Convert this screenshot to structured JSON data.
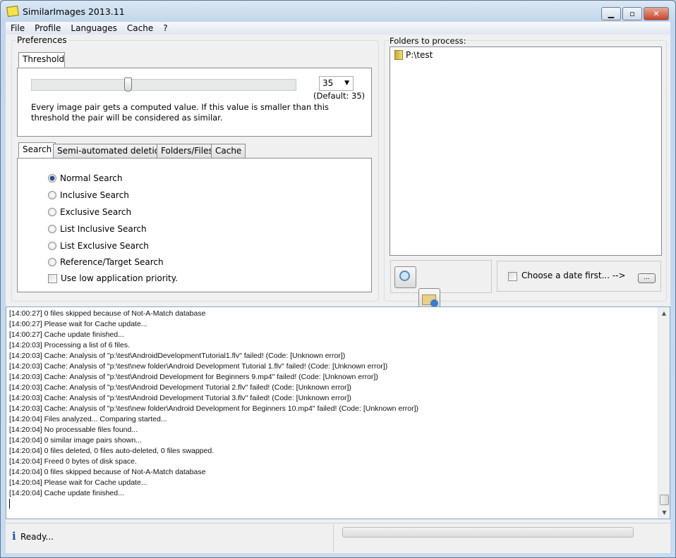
{
  "window": {
    "title": "SimilarImages 2013.11"
  },
  "menu": [
    "File",
    "Profile",
    "Languages",
    "Cache",
    "?"
  ],
  "preferences": {
    "label": "Preferences",
    "threshold_tab": "Threshold",
    "threshold_value": "35",
    "threshold_fraction": 0.35,
    "default_label": "(Default: 35)",
    "description": "Every image pair gets a computed value. If this value is smaller than this threshold the pair will be considered as similar."
  },
  "tabs": [
    "Search",
    "Semi-automated deletion",
    "Folders/Files",
    "Cache"
  ],
  "search": {
    "options": [
      "Normal Search",
      "Inclusive Search",
      "Exclusive Search",
      "List Inclusive Search",
      "List Exclusive Search",
      "Reference/Target Search"
    ],
    "selected": "Normal Search",
    "low_priority": "Use low application priority."
  },
  "folders": {
    "label": "Folders to process:",
    "items": [
      "P:\\test"
    ]
  },
  "date": {
    "label": "Choose a date first... -->",
    "button": "..."
  },
  "log": [
    "[14:00:27] 0 files skipped because of Not-A-Match database",
    "[14:00:27] Please wait for Cache update...",
    "[14:00:27] Cache update finished...",
    "[14:20:03] Processing a list of 6 files.",
    "[14:20:03] Cache: Analysis of \"p:\\test\\AndroidDevelopmentTutorial1.flv\" failed! (Code: [Unknown error])",
    "[14:20:03] Cache: Analysis of \"p:\\test\\new folder\\Android Development Tutorial 1.flv\" failed! (Code: [Unknown error])",
    "[14:20:03] Cache: Analysis of \"p:\\test\\Android Development for Beginners 9.mp4\" failed! (Code: [Unknown error])",
    "[14:20:03] Cache: Analysis of \"p:\\test\\Android Development Tutorial 2.flv\" failed! (Code: [Unknown error])",
    "[14:20:03] Cache: Analysis of \"p:\\test\\Android Development Tutorial 3.flv\" failed! (Code: [Unknown error])",
    "[14:20:03] Cache: Analysis of \"p:\\test\\new folder\\Android Development for Beginners 10.mp4\" failed! (Code: [Unknown error])",
    "[14:20:04] Files analyzed... Comparing started...",
    "[14:20:04] No processable files found...",
    "[14:20:04] 0 similar image pairs shown...",
    "[14:20:04] 0 files deleted, 0 files auto-deleted, 0 files swapped.",
    "[14:20:04] Freed 0 bytes of disk space.",
    "[14:20:04] 0 files skipped because of Not-A-Match database",
    "[14:20:04] Please wait for Cache update...",
    "[14:20:04] Cache update finished..."
  ],
  "status": {
    "text": "Ready...",
    "progress": 0
  }
}
